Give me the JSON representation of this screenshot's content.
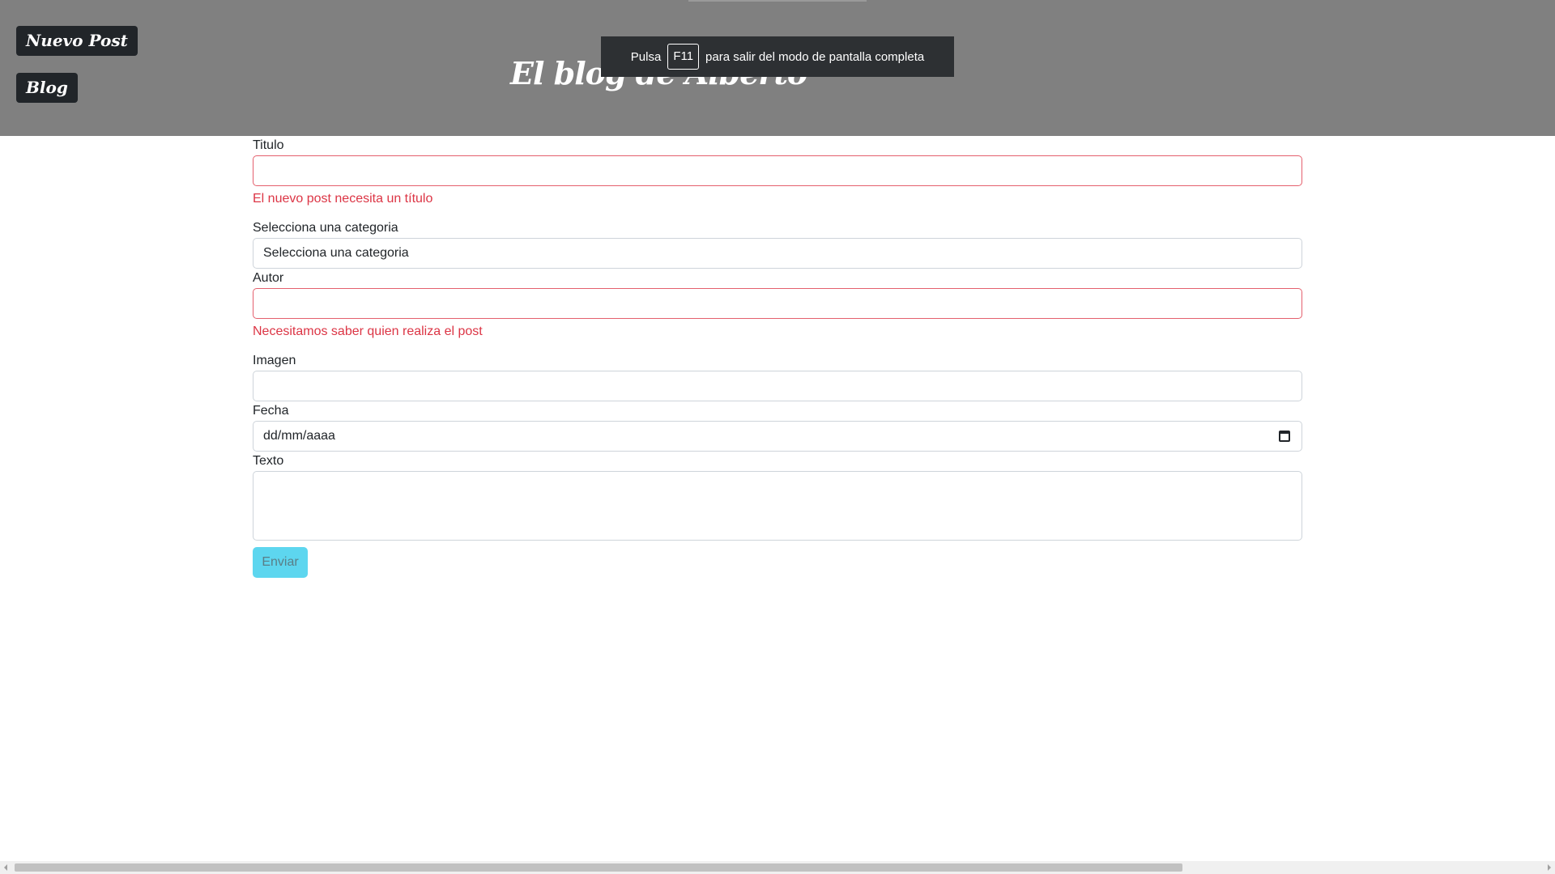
{
  "header": {
    "nav_new_post": "Nuevo Post",
    "nav_blog": "Blog",
    "title": "El blog de Alberto"
  },
  "fullscreen_toast": {
    "prefix": "Pulsa",
    "key": "F11",
    "suffix": "para salir del modo de pantalla completa"
  },
  "form": {
    "title_label": "Titulo",
    "title_value": "",
    "title_error": "El nuevo post necesita un título",
    "category_label": "Selecciona una categoria",
    "category_selected": "Selecciona una categoria",
    "author_label": "Autor",
    "author_value": "",
    "author_error": "Necesitamos saber quien realiza el post",
    "image_label": "Imagen",
    "image_value": "",
    "date_label": "Fecha",
    "date_placeholder": "dd/mm/aaaa",
    "text_label": "Texto",
    "text_value": "",
    "submit_label": "Enviar"
  },
  "colors": {
    "header_bg": "#808080",
    "nav_bg": "#212529",
    "error": "#dc3545",
    "submit_bg": "#5dd6ef"
  },
  "icons": {
    "date_picker": "calendar-icon"
  }
}
